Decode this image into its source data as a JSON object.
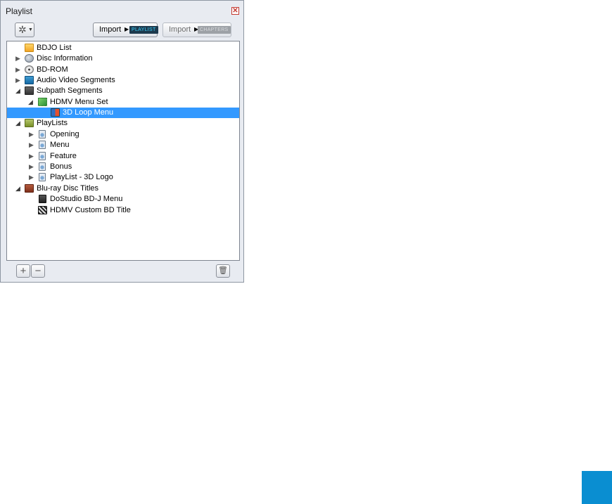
{
  "panel": {
    "title": "Playlist",
    "close_glyph": "✕"
  },
  "toolbar": {
    "gear_glyph": "✲",
    "caret_glyph": "▼",
    "import_playlist": {
      "label": "Import",
      "arrow": "▶",
      "tag": "PLAYLIST"
    },
    "import_chapters": {
      "label": "Import",
      "arrow": "▶",
      "tag": "CHAPTERS"
    }
  },
  "tree": {
    "items": [
      {
        "label": "BDJO List",
        "icon": "folder-yellow-icon"
      },
      {
        "label": "Disc Information",
        "icon": "disc-info-icon"
      },
      {
        "label": "BD-ROM",
        "icon": "disc-icon"
      },
      {
        "label": "Audio Video Segments",
        "icon": "folder-blue-icon"
      },
      {
        "label": "Subpath Segments",
        "icon": "folder-dark-icon"
      },
      {
        "label": "HDMV Menu Set",
        "icon": "menu-set-icon"
      },
      {
        "label": "3D Loop Menu",
        "icon": "loop-menu-icon",
        "selected": true
      },
      {
        "label": "PlayLists",
        "icon": "folder-olive-icon"
      },
      {
        "label": "Opening",
        "icon": "playlist-icon"
      },
      {
        "label": "Menu",
        "icon": "playlist-icon"
      },
      {
        "label": "Feature",
        "icon": "playlist-icon"
      },
      {
        "label": "Bonus",
        "icon": "playlist-icon"
      },
      {
        "label": "PlayList - 3D Logo",
        "icon": "playlist-icon"
      },
      {
        "label": "Blu-ray Disc Titles",
        "icon": "folder-brown-icon"
      },
      {
        "label": "DoStudio BD-J Menu",
        "icon": "bdj-title-icon"
      },
      {
        "label": "HDMV Custom BD Title",
        "icon": "clapper-icon"
      }
    ],
    "expanded_glyph": "◢",
    "collapsed_glyph": "▶"
  },
  "bottom": {
    "add_glyph": "+",
    "remove_glyph": "−",
    "trash_glyph": "🗑"
  },
  "colors": {
    "selection": "#3399ff",
    "accent_square": "#0a8ed1"
  }
}
